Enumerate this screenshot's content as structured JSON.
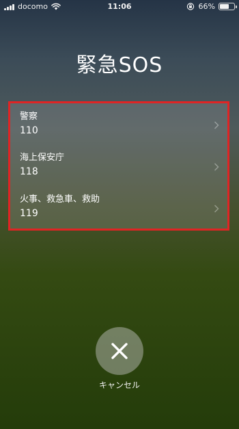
{
  "status_bar": {
    "carrier": "docomo",
    "time": "11:06",
    "battery_percent": "66%",
    "battery_level": 0.66,
    "signal_icon": "signal-bars-icon",
    "wifi_icon": "wifi-icon",
    "rotation_lock_icon": "rotation-lock-icon",
    "battery_icon": "battery-icon"
  },
  "title": "緊急SOS",
  "emergency_contacts": [
    {
      "label": "警察",
      "number": "110"
    },
    {
      "label": "海上保安庁",
      "number": "118"
    },
    {
      "label": "火事、救急車、救助",
      "number": "119"
    }
  ],
  "cancel": {
    "label": "キャンセル",
    "icon": "close-icon"
  },
  "colors": {
    "highlight_border": "#e02424",
    "text": "#ffffff",
    "button_bg": "rgba(200,200,200,0.45)"
  }
}
